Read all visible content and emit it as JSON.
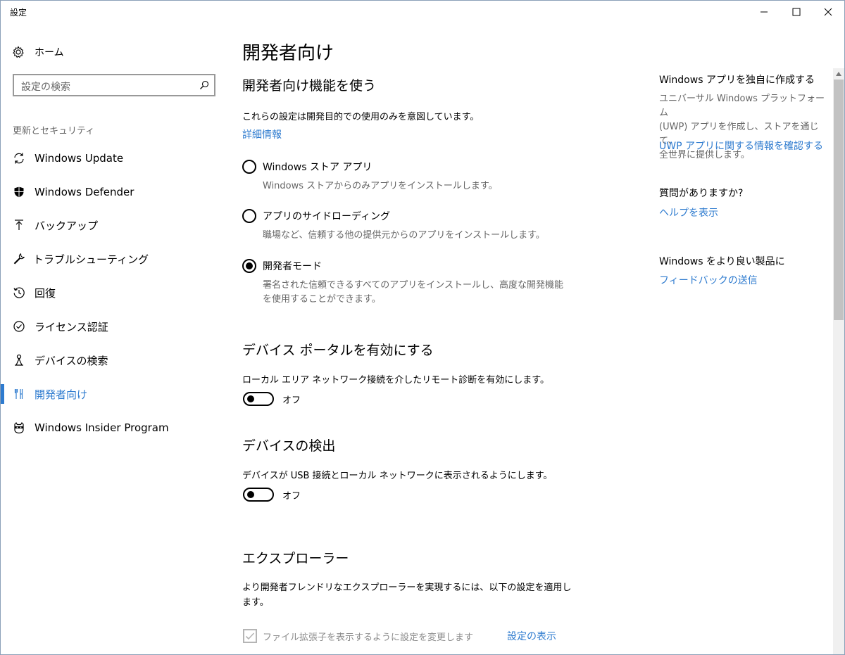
{
  "window": {
    "title": "設定"
  },
  "sidebar": {
    "home_label": "ホーム",
    "search_placeholder": "設定の検索",
    "section_label": "更新とセキュリティ",
    "items": [
      {
        "label": "Windows Update",
        "icon": "sync-icon"
      },
      {
        "label": "Windows Defender",
        "icon": "shield-icon"
      },
      {
        "label": "バックアップ",
        "icon": "upload-arrow-icon"
      },
      {
        "label": "トラブルシューティング",
        "icon": "wrench-icon"
      },
      {
        "label": "回復",
        "icon": "history-icon"
      },
      {
        "label": "ライセンス認証",
        "icon": "checkmark-circle-icon"
      },
      {
        "label": "デバイスの検索",
        "icon": "person-location-icon"
      },
      {
        "label": "開発者向け",
        "icon": "developer-tools-icon",
        "active": true
      },
      {
        "label": "Windows Insider Program",
        "icon": "ninja-cat-icon"
      }
    ]
  },
  "main": {
    "title": "開発者向け",
    "dev_features": {
      "heading": "開発者向け機能を使う",
      "description": "これらの設定は開発目的での使用のみを意図しています。",
      "details_link": "詳細情報",
      "options": [
        {
          "label": "Windows ストア アプリ",
          "description": "Windows ストアからのみアプリをインストールします。",
          "checked": false
        },
        {
          "label": "アプリのサイドローディング",
          "description": "職場など、信頼する他の提供元からのアプリをインストールします。",
          "checked": false
        },
        {
          "label": "開発者モード",
          "description_line1": "署名された信頼できるすべてのアプリをインストールし、高度な開発機能",
          "description_line2": "を使用することができます。",
          "checked": true
        }
      ]
    },
    "device_portal": {
      "heading": "デバイス ポータルを有効にする",
      "description": "ローカル エリア ネットワーク接続を介したリモート診断を有効にします。",
      "toggle_state": "オフ"
    },
    "device_discovery": {
      "heading": "デバイスの検出",
      "description": "デバイスが USB 接続とローカル ネットワークに表示されるようにします。",
      "toggle_state": "オフ"
    },
    "explorer": {
      "heading": "エクスプローラー",
      "description_line1": "より開発者フレンドリなエクスプローラーを実現するには、以下の設定を適用し",
      "description_line2": "ます。",
      "checkbox_label": "ファイル拡張子を表示するように設定を変更します",
      "show_settings_link": "設定の表示"
    }
  },
  "right_panel": {
    "section1": {
      "heading": "Windows アプリを独自に作成する",
      "text_line1": "ユニバーサル Windows プラットフォーム",
      "text_line2": "(UWP) アプリを作成し、ストアを通じて、",
      "text_line3": "全世界に提供します。",
      "link": "UWP アプリに関する情報を確認する"
    },
    "section2": {
      "heading": "質問がありますか?",
      "link": "ヘルプを表示"
    },
    "section3": {
      "heading": "Windows をより良い製品に",
      "link": "フィードバックの送信"
    }
  },
  "colors": {
    "accent": "#2e7bcf",
    "secondary_text": "#666666",
    "disabled_text": "#8c8c8c"
  }
}
